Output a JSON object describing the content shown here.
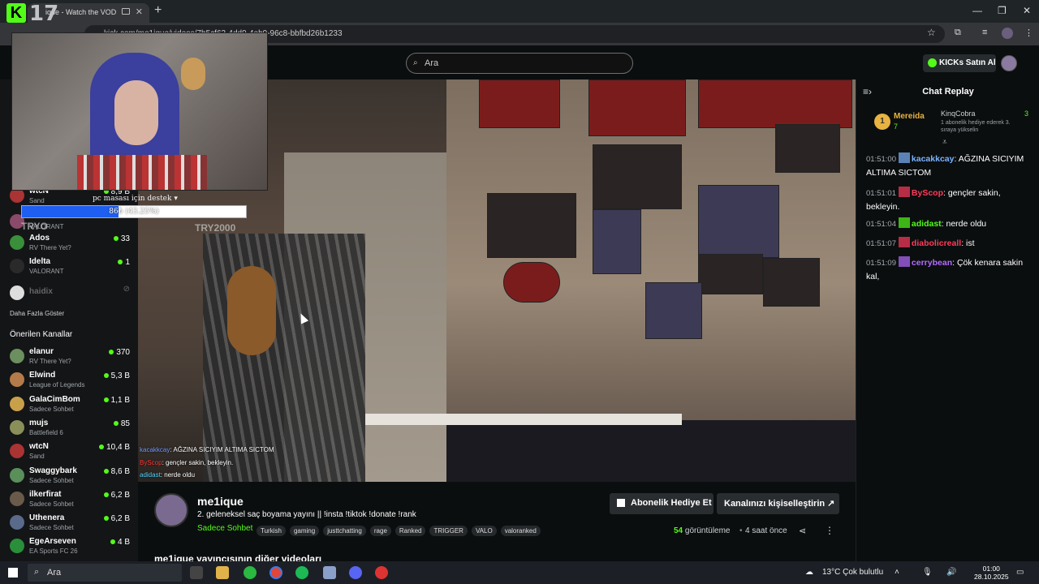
{
  "browser": {
    "tab_title": "ique - Watch the VOD",
    "url": "kick.com/me1ique/videos/7b5cf63-4dd9-4eb9-96c8-bbfbd26b1233",
    "logo_text": "17"
  },
  "header": {
    "search_placeholder": "Ara",
    "kicks_button": "KICKs Satın Al"
  },
  "sidebar": {
    "followed": [
      {
        "name": "wtcN",
        "category": "Sand",
        "count": "8,9 B"
      },
      {
        "name": "TRYO",
        "category": "VALORANT",
        "count": ""
      },
      {
        "name": "Ados",
        "category": "RV There Yet?",
        "count": "33"
      },
      {
        "name": "Idelta",
        "category": "VALORANT",
        "count": "1"
      },
      {
        "name": "haidix",
        "category": "",
        "count": ""
      }
    ],
    "show_more": "Daha Fazla Göster",
    "recommended_title": "Önerilen Kanallar",
    "recommended": [
      {
        "name": "elanur",
        "category": "RV There Yet?",
        "count": "370",
        "color": "#6b8f5e"
      },
      {
        "name": "Elwind",
        "category": "League of Legends",
        "count": "5,3 B",
        "color": "#b57a4a"
      },
      {
        "name": "GalaCimBom",
        "category": "Sadece Sohbet",
        "count": "1,1 B",
        "color": "#c9a04a"
      },
      {
        "name": "mujs",
        "category": "Battlefield 6",
        "count": "85",
        "color": "#8a8f5a"
      },
      {
        "name": "wtcN",
        "category": "Sand",
        "count": "10,4 B",
        "color": "#a33"
      },
      {
        "name": "Swaggybark",
        "category": "Sadece Sohbet",
        "count": "8,6 B",
        "color": "#5a8f5a"
      },
      {
        "name": "ilkerfirat",
        "category": "Sadece Sohbet",
        "count": "6,2 B",
        "color": "#6a5a4a"
      },
      {
        "name": "Uthenera",
        "category": "Sadece Sohbet",
        "count": "6,2 B",
        "color": "#5a6a8a"
      },
      {
        "name": "EgeArseven",
        "category": "EA Sports FC 26",
        "count": "4 B",
        "color": "#2a8f3a"
      }
    ]
  },
  "overlay": {
    "goal_text": "pc masası için destek ▾",
    "goal_label": "86₺ (43.25%)",
    "goal_progress": 0.4325,
    "watermark": "TRY2000",
    "watermark_left": "TRYO",
    "vod_chat": [
      {
        "user": "kacakkcay",
        "text": ": AĞZINA SICIYIM ALTIMA SICTOM"
      },
      {
        "user": "ByScop",
        "text": ": gençler sakin, bekleyin."
      },
      {
        "user": "adidast",
        "text": ": nerde oldu"
      }
    ]
  },
  "chat": {
    "title": "Chat Replay",
    "top_gifter": {
      "rank": "1",
      "name": "Mereida",
      "count": "7"
    },
    "second_gifter": {
      "name": "KinqCobra",
      "count": "3",
      "sub": "1 abonelik hediye ederek 3. sıraya yükselin"
    },
    "messages": [
      {
        "time": "01:51:00",
        "user": "kacakkcay",
        "text": ": AĞZINA SICIYIM ALTIMA SICTOM",
        "color": "#7cb3ff"
      },
      {
        "time": "01:51:01",
        "user": "ByScop",
        "text": ": gençler sakin, bekleyin.",
        "color": "#ff3b5c"
      },
      {
        "time": "01:51:04",
        "user": "adidast",
        "text": ": nerde oldu",
        "color": "#53fc18"
      },
      {
        "time": "01:51:07",
        "user": "diabolicreall",
        "text": ": ist",
        "color": "#ff3b5c"
      },
      {
        "time": "01:51:09",
        "user": "cerrybean",
        "text": ": Çök kenara sakin kal,",
        "color": "#b36bff"
      }
    ]
  },
  "channel": {
    "name": "me1ique",
    "title": "2. geleneksel saç boyama yayını || !insta !tiktok !donate !rank",
    "category": "Sadece Sohbet",
    "tags": [
      "Turkish",
      "gaming",
      "justtchatting",
      "rage",
      "Ranked",
      "TRIGGER",
      "VALO",
      "valoranked"
    ],
    "gift_button": "Abonelik Hediye Et",
    "customize_button": "Kanalınızı kişiselleştirin ↗",
    "views_count": "54",
    "views_label": "görüntüleme",
    "time_ago": "4 saat önce",
    "other_videos": "me1ique yayıncısının diğer videoları"
  },
  "taskbar": {
    "search": "Ara",
    "weather": "13°C  Çok bulutlu",
    "time": "01:00",
    "date": "28.10.2025"
  }
}
